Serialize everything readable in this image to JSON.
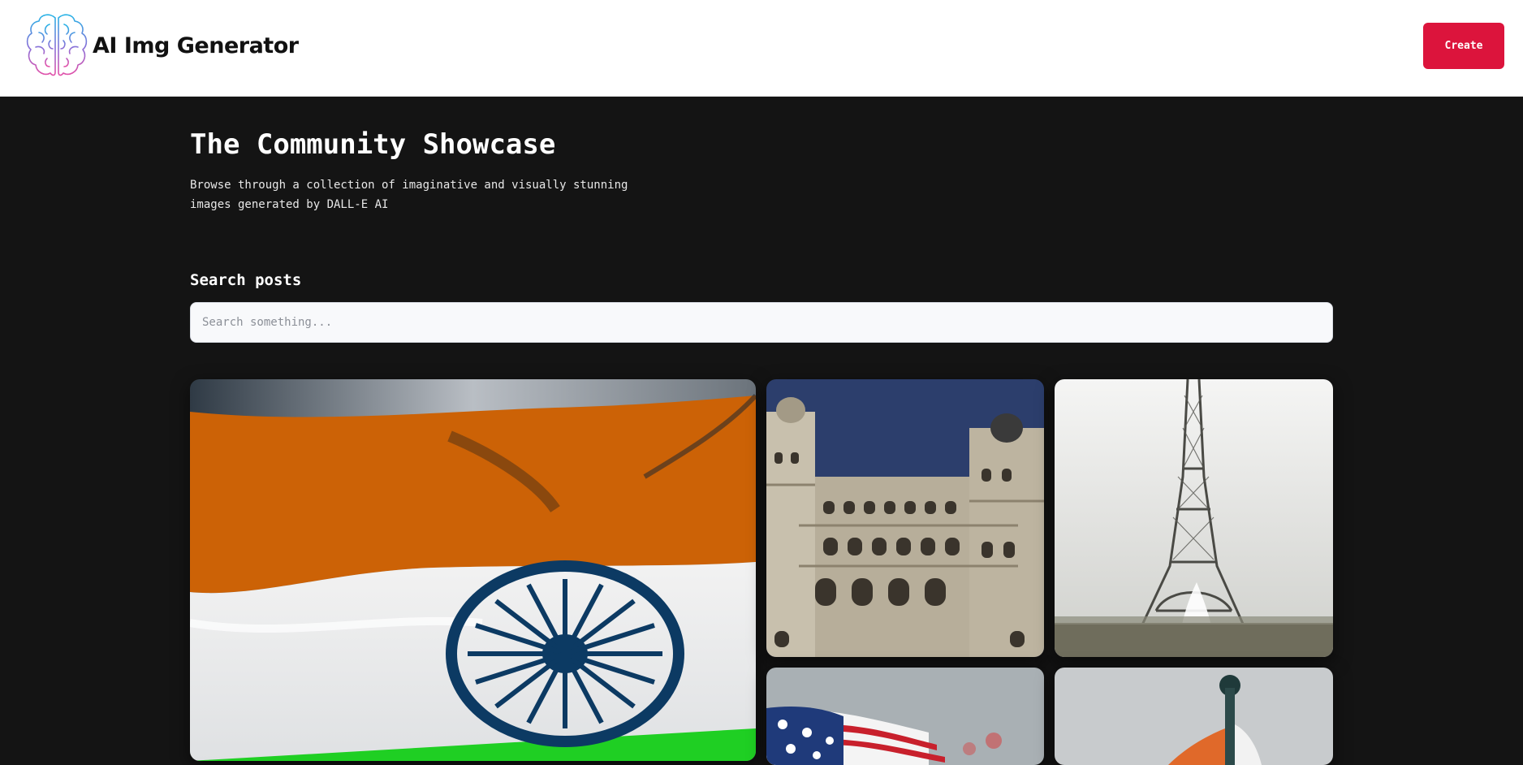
{
  "header": {
    "brand_name": "AI Img Generator",
    "logo_icon": "brain-icon",
    "create_label": "Create",
    "colors": {
      "accent": "#dc143c",
      "header_bg": "#ffffff",
      "page_bg": "#141414"
    }
  },
  "main": {
    "title": "The Community Showcase",
    "subtitle": "Browse through a collection of imaginative and visually stunning images generated by DALL-E AI",
    "search": {
      "label": "Search posts",
      "placeholder": "Search something...",
      "value": ""
    }
  }
}
